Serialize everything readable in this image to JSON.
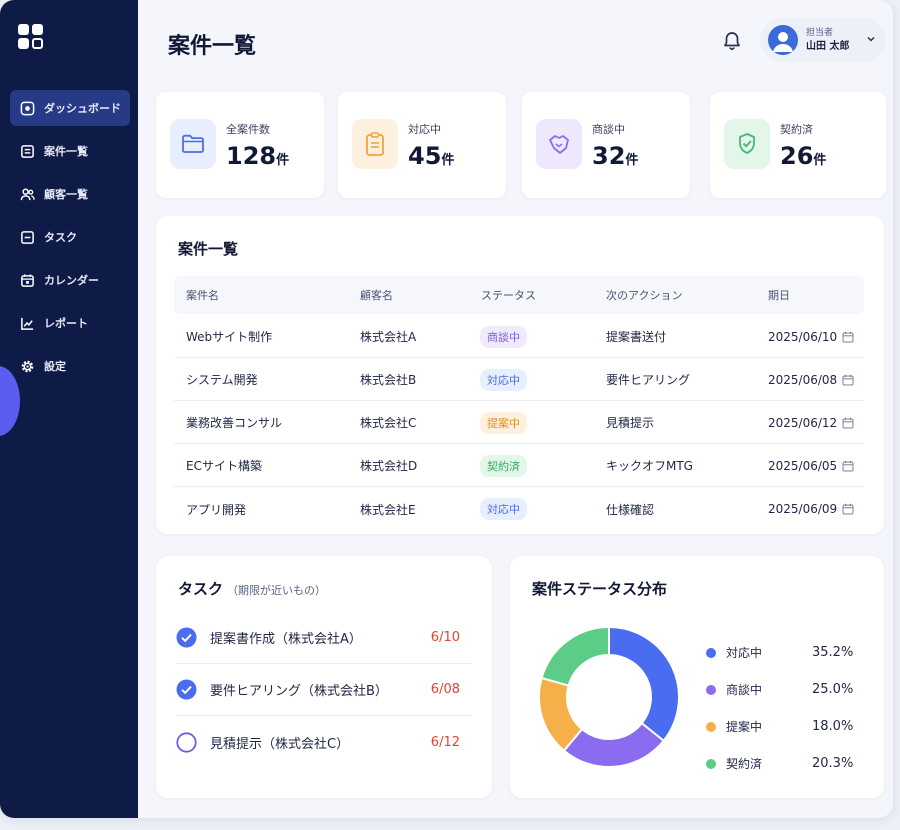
{
  "colors": {
    "sidebar": "#0f1b47",
    "accent": "#4a6cf0",
    "blue": "#4a6cf0",
    "purple": "#8b6cf0",
    "orange": "#f5b04a",
    "green": "#5ccc86",
    "due_red": "#e0442f"
  },
  "sidebar": {
    "items": [
      {
        "label": "ダッシュボード",
        "icon": "dashboard-icon",
        "active": true
      },
      {
        "label": "案件一覧",
        "icon": "list-icon",
        "active": false
      },
      {
        "label": "顧客一覧",
        "icon": "users-icon",
        "active": false
      },
      {
        "label": "タスク",
        "icon": "task-icon",
        "active": false
      },
      {
        "label": "カレンダー",
        "icon": "calendar-icon",
        "active": false
      },
      {
        "label": "レポート",
        "icon": "report-icon",
        "active": false
      },
      {
        "label": "設定",
        "icon": "gear-icon",
        "active": false
      }
    ]
  },
  "header": {
    "title": "案件一覧",
    "user_role": "担当者",
    "user_name": "山田 太郎"
  },
  "stats": [
    {
      "label": "全案件数",
      "value": "128",
      "unit": "件",
      "icon": "folder-icon"
    },
    {
      "label": "対応中",
      "value": "45",
      "unit": "件",
      "icon": "clipboard-icon"
    },
    {
      "label": "商談中",
      "value": "32",
      "unit": "件",
      "icon": "handshake-icon"
    },
    {
      "label": "契約済",
      "value": "26",
      "unit": "件",
      "icon": "check-badge-icon"
    }
  ],
  "table": {
    "title": "案件一覧",
    "headers": [
      "案件名",
      "顧客名",
      "ステータス",
      "次のアクション",
      "期日"
    ],
    "rows": [
      {
        "name": "Webサイト制作",
        "client": "株式会社A",
        "status": "商談中",
        "status_kind": "purple",
        "action": "提案書送付",
        "due": "2025/06/10"
      },
      {
        "name": "システム開発",
        "client": "株式会社B",
        "status": "対応中",
        "status_kind": "blue",
        "action": "要件ヒアリング",
        "due": "2025/06/08"
      },
      {
        "name": "業務改善コンサル",
        "client": "株式会社C",
        "status": "提案中",
        "status_kind": "orange",
        "action": "見積提示",
        "due": "2025/06/12"
      },
      {
        "name": "ECサイト構築",
        "client": "株式会社D",
        "status": "契約済",
        "status_kind": "green",
        "action": "キックオフMTG",
        "due": "2025/06/05"
      },
      {
        "name": "アプリ開発",
        "client": "株式会社E",
        "status": "対応中",
        "status_kind": "blue",
        "action": "仕様確認",
        "due": "2025/06/09"
      }
    ]
  },
  "tasks": {
    "title": "タスク",
    "subtitle": "（期限が近いもの）",
    "items": [
      {
        "label": "提案書作成（株式会社A）",
        "due": "6/10",
        "done": true
      },
      {
        "label": "要件ヒアリング（株式会社B）",
        "due": "6/08",
        "done": true
      },
      {
        "label": "見積提示（株式会社C）",
        "due": "6/12",
        "done": false
      }
    ]
  },
  "chart_data": {
    "type": "pie",
    "title": "案件ステータス分布",
    "categories": [
      "対応中",
      "商談中",
      "提案中",
      "契約済"
    ],
    "values": [
      35.2,
      25.0,
      18.0,
      20.3
    ],
    "labels": [
      "35.2%",
      "25.0%",
      "18.0%",
      "20.3%"
    ],
    "colors": [
      "#4a6cf0",
      "#8b6cf0",
      "#f5b04a",
      "#5ccc86"
    ],
    "donut": true,
    "legend": "right"
  }
}
